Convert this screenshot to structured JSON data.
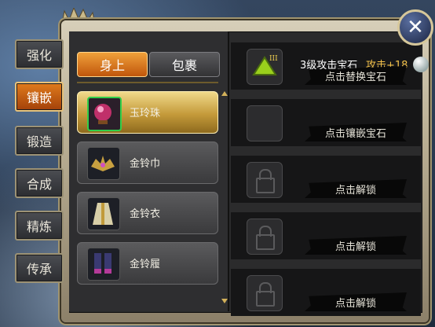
{
  "side_tabs": [
    {
      "label": "强化",
      "active": false
    },
    {
      "label": "镶嵌",
      "active": true
    },
    {
      "label": "锻造",
      "active": false
    },
    {
      "label": "合成",
      "active": false
    },
    {
      "label": "精炼",
      "active": false
    },
    {
      "label": "传承",
      "active": false
    }
  ],
  "toggle": {
    "equipped": "身上",
    "bag": "包裹"
  },
  "items": [
    {
      "name": "玉玲珠",
      "icon": "pearl-orb-icon",
      "active": true
    },
    {
      "name": "金铃巾",
      "icon": "headband-icon",
      "active": false
    },
    {
      "name": "金铃衣",
      "icon": "robe-icon",
      "active": false
    },
    {
      "name": "金铃履",
      "icon": "boots-icon",
      "active": false
    }
  ],
  "slots": [
    {
      "gem_name": "3级攻击宝石",
      "gem_stat": "攻击+18",
      "button": "点击替换宝石",
      "state": "gem",
      "gem_level": "III"
    },
    {
      "gem_name": "",
      "gem_stat": "",
      "button": "点击镶嵌宝石",
      "state": "empty"
    },
    {
      "gem_name": "",
      "gem_stat": "",
      "button": "点击解锁",
      "state": "locked"
    },
    {
      "gem_name": "",
      "gem_stat": "",
      "button": "点击解锁",
      "state": "locked"
    },
    {
      "gem_name": "",
      "gem_stat": "",
      "button": "点击解锁",
      "state": "locked"
    }
  ],
  "close_icon": "close-icon",
  "colors": {
    "accent": "#e07b1c",
    "gem_stat": "#f3c14a",
    "active_item": "#c49a3a"
  }
}
